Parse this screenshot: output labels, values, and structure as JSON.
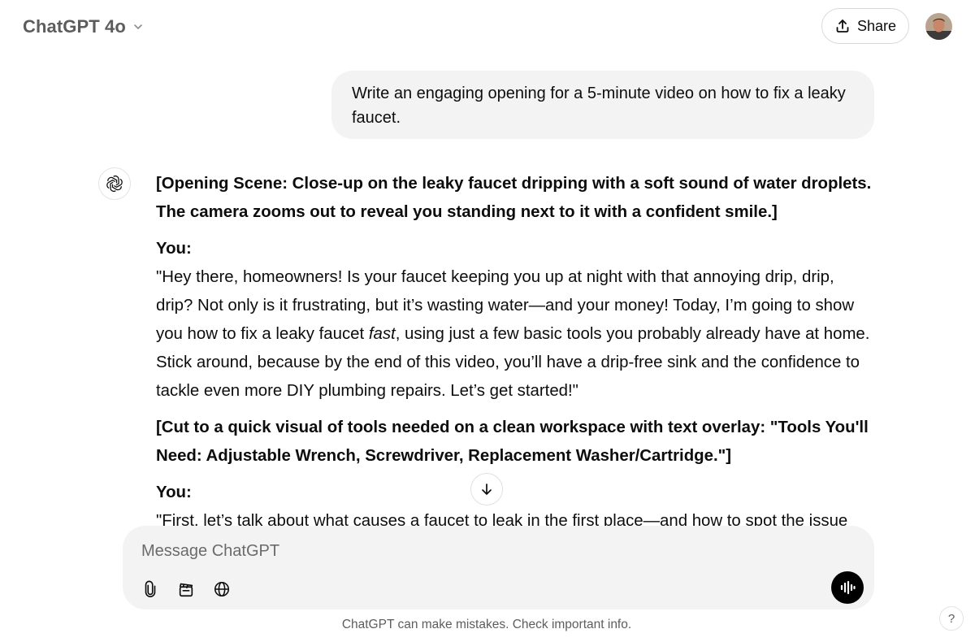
{
  "header": {
    "model_name": "ChatGPT 4o",
    "share_label": "Share"
  },
  "conversation": {
    "user_message": "Write an engaging opening for a 5-minute video on how to fix a leaky faucet.",
    "assistant": {
      "scene_1": "[Opening Scene: Close-up on the leaky faucet dripping with a soft sound of water droplets. The camera zooms out to reveal you standing next to it with a confident smile.]",
      "speaker_1": "You:",
      "line_1_before": "\"Hey there, homeowners! Is your faucet keeping you up at night with that annoying drip, drip, drip? Not only is it frustrating, but it’s wasting water—and your money! Today, I’m going to show you how to fix a leaky faucet ",
      "line_1_emphasis": "fast",
      "line_1_after": ", using just a few basic tools you probably already have at home. Stick around, because by the end of this video, you’ll have a drip-free sink and the confidence to tackle even more DIY plumbing repairs. Let’s get started!\"",
      "scene_2": "[Cut to a quick visual of tools needed on a clean workspace with text overlay: \"Tools You'll Need: Adjustable Wrench, Screwdriver, Replacement Washer/Cartridge.\"]",
      "speaker_2": "You:",
      "line_2": "\"First, let’s talk about what causes a faucet to leak in the first place—and how to spot the issue before"
    }
  },
  "composer": {
    "placeholder": "Message ChatGPT",
    "value": ""
  },
  "footer": {
    "disclaimer": "ChatGPT can make mistakes. Check important info.",
    "help_label": "?"
  },
  "icons": {
    "model_chevron": "chevron-down-icon",
    "share": "upload-icon",
    "assistant": "openai-logo-icon",
    "scroll_down": "arrow-down-icon",
    "attach": "paperclip-icon",
    "tools": "clapperboard-icon",
    "search": "globe-icon",
    "voice": "voice-wave-icon"
  },
  "colors": {
    "bubble_bg": "#f3f3f3",
    "text": "#0d0d0d",
    "muted": "#5d5d5d",
    "voice_button": "#000000"
  }
}
